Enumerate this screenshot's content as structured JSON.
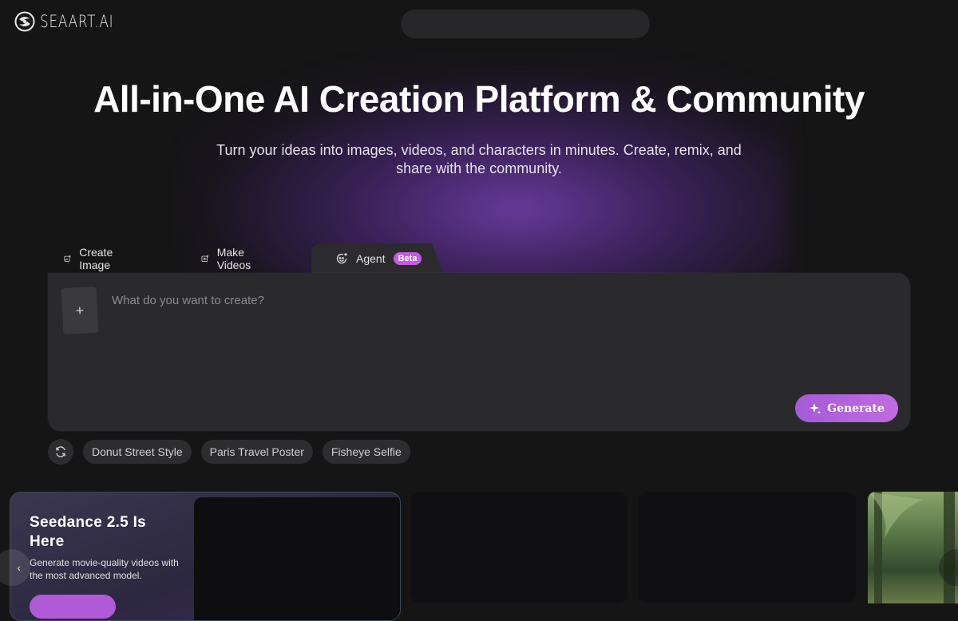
{
  "brand": {
    "name": "SEAART.AI",
    "logo_icon": "seaart-swirl-logo-icon"
  },
  "hero": {
    "title": "All-in-One AI Creation Platform & Community",
    "subtitle": "Turn your ideas into images, videos, and characters in minutes. Create, remix, and share with the community."
  },
  "tabs": [
    {
      "label": "Create Image",
      "icon": "image-plus-icon"
    },
    {
      "label": "Make Videos",
      "icon": "video-plus-icon"
    },
    {
      "label": "Agent",
      "icon": "agent-icon",
      "badge": "Beta",
      "active": true
    }
  ],
  "prompt": {
    "placeholder": "What do you want to create?",
    "upload_symbol": "+",
    "generate_label": "Generate"
  },
  "suggestions": [
    "Donut Street Style",
    "Paris Travel Poster",
    "Fisheye Selfie"
  ],
  "feature_card": {
    "title": "Seedance 2.5 Is Here",
    "description": "Generate movie-quality videos with the most advanced model."
  },
  "colors": {
    "accent": "#b05ad8",
    "background": "#151516",
    "badge": "#c55be0"
  }
}
